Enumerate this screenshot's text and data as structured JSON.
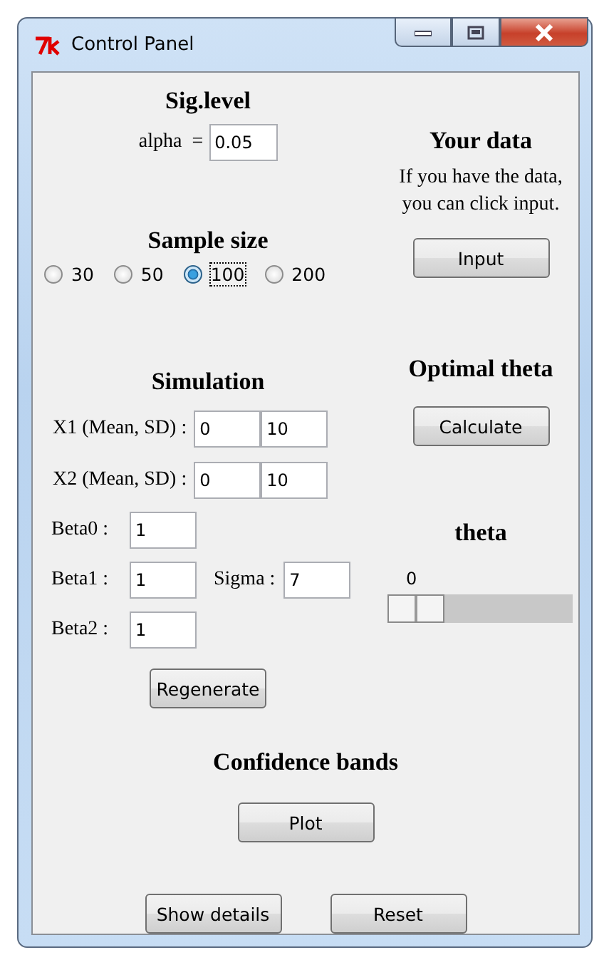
{
  "window": {
    "title": "Control Panel"
  },
  "sig_level": {
    "heading": "Sig.level",
    "label": "alpha  =",
    "value": "0.05"
  },
  "sample_size": {
    "heading": "Sample size",
    "options": [
      {
        "label": "30",
        "selected": false
      },
      {
        "label": "50",
        "selected": false
      },
      {
        "label": "100",
        "selected": true
      },
      {
        "label": "200",
        "selected": false
      }
    ]
  },
  "simulation": {
    "heading": "Simulation",
    "pairs": [
      {
        "label": "X1 (Mean, SD) :",
        "values": [
          "0",
          "10"
        ]
      },
      {
        "label": "X2 (Mean, SD) :",
        "values": [
          "0",
          "10"
        ]
      }
    ],
    "params": [
      {
        "label": "Beta0 :",
        "value": "1"
      },
      {
        "label": "Beta1 :",
        "value": "1",
        "extra": {
          "label": "Sigma :",
          "value": "7"
        }
      },
      {
        "label": "Beta2 :",
        "value": "1"
      }
    ],
    "button": "Regenerate"
  },
  "your_data": {
    "heading": "Your data",
    "text": [
      "If you have the data,",
      "you can click input."
    ],
    "button": "Input"
  },
  "optimal_theta": {
    "heading": "Optimal theta",
    "button": "Calculate"
  },
  "theta": {
    "heading": "theta",
    "reading": "0",
    "level": 0
  },
  "confidence_bands": {
    "heading": "Confidence bands",
    "button": "Plot"
  },
  "footer_buttons": [
    "Show details",
    "Reset"
  ]
}
